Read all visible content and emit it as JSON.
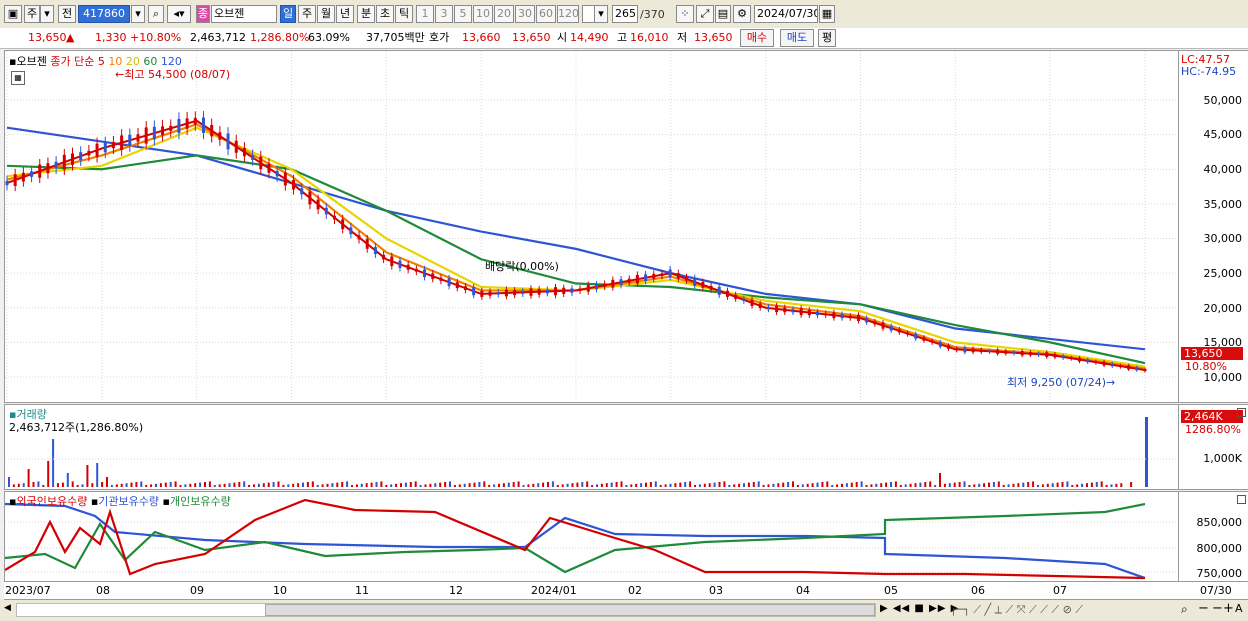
{
  "toolbar": {
    "period_type": "주",
    "compare": "전",
    "code": "417860",
    "name": "오브젠",
    "periods": [
      "일",
      "주",
      "월",
      "년",
      "분",
      "초",
      "틱"
    ],
    "intervals": [
      "1",
      "3",
      "5",
      "10",
      "20",
      "30",
      "60",
      "120"
    ],
    "count": "265",
    "total": "/370",
    "date": "2024/07/30"
  },
  "info": {
    "price": "13,650",
    "arrow": "▲",
    "change": "1,330",
    "change_pct": "+10.80%",
    "volume": "2,463,712",
    "volume_pct": "1,286.80%",
    "turnover": "63.09%",
    "amount": "37,705백만",
    "ask_label": "호가",
    "ask": "13,660",
    "bid": "13,650",
    "open_label": "시",
    "open": "14,490",
    "high_label": "고",
    "high": "16,010",
    "low_label": "저",
    "low": "13,650",
    "buy": "매수",
    "sell": "매도",
    "eval": "평"
  },
  "price_panel": {
    "legend_name": "오브젠",
    "legend_type": "종가 단순",
    "ma": [
      "5",
      "10",
      "20",
      "60",
      "120"
    ],
    "ma_colors": [
      "#d40000",
      "#f08000",
      "#e8d400",
      "#1f8a3a",
      "#2f55d4"
    ],
    "lc": "LC:47.57",
    "hc": "HC:-74.95",
    "max_label": "최고 54,500 (08/07)",
    "min_label": "최저 9,250 (07/24)",
    "dividend_label": "배당락(0.00%)",
    "yticks": [
      "50,000",
      "45,000",
      "40,000",
      "35,000",
      "30,000",
      "25,000",
      "20,000",
      "15,000",
      "10,000"
    ],
    "last_badge": "13,650",
    "last_pct": "10.80%"
  },
  "volume_panel": {
    "title": "거래량",
    "value": "2,463,712주(1,286.80%)",
    "badge": "2,464K",
    "badge_pct": "1286.80%",
    "ytick": "1,000K"
  },
  "holding_panel": {
    "foreign": "외국인보유수량",
    "inst": "기관보유수량",
    "indiv": "개인보유수량",
    "yticks": [
      "850,000",
      "800,000",
      "750,000"
    ]
  },
  "xaxis": [
    "2023/07",
    "08",
    "09",
    "10",
    "11",
    "12",
    "2024/01",
    "02",
    "03",
    "04",
    "05",
    "06",
    "07",
    "07/30"
  ],
  "chart_data": {
    "type": "line",
    "title": "",
    "x": [
      "2023/07",
      "08",
      "09",
      "10",
      "11",
      "12",
      "2024/01",
      "02",
      "03",
      "04",
      "05",
      "06",
      "07"
    ],
    "ylim": [
      8000,
      56000
    ],
    "series": [
      {
        "name": "5",
        "values": [
          38000,
          43000,
          47000,
          38000,
          27000,
          22000,
          22500,
          25000,
          20000,
          18500,
          14000,
          13200,
          11000
        ]
      },
      {
        "name": "10",
        "values": [
          38500,
          42000,
          46500,
          39000,
          28000,
          22500,
          22500,
          24500,
          20500,
          18800,
          14300,
          13300,
          11200
        ]
      },
      {
        "name": "20",
        "values": [
          39000,
          40500,
          46000,
          40000,
          30000,
          23000,
          22500,
          24000,
          21000,
          19500,
          15000,
          13600,
          11500
        ]
      },
      {
        "name": "60",
        "values": [
          40500,
          40000,
          42000,
          40000,
          34000,
          27000,
          23500,
          23000,
          21500,
          20500,
          17500,
          15000,
          12000
        ]
      },
      {
        "name": "120",
        "values": [
          46000,
          44000,
          42000,
          38000,
          34000,
          31000,
          28500,
          25000,
          22000,
          20500,
          17000,
          15500,
          14000
        ]
      }
    ]
  }
}
